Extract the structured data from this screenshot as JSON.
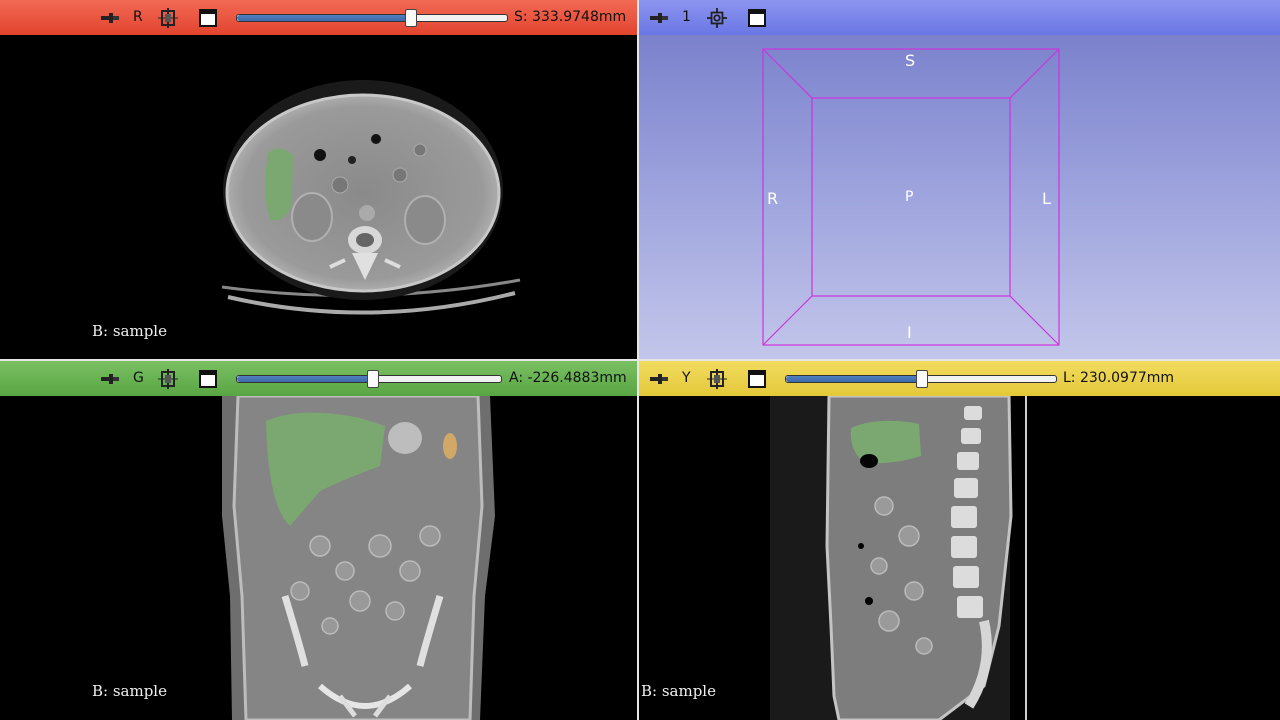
{
  "panes": {
    "red": {
      "view_label": "R",
      "offset": "S: 333.9748mm",
      "slider_fraction": 0.64,
      "caption": "B: sample"
    },
    "threed": {
      "view_label": "1",
      "orient": {
        "top": "S",
        "bottom": "I",
        "left": "R",
        "right": "L",
        "center": "P"
      }
    },
    "green": {
      "view_label": "G",
      "offset": "A: -226.4883mm",
      "slider_fraction": 0.51,
      "caption": "B: sample"
    },
    "yellow": {
      "view_label": "Y",
      "offset": "L: 230.0977mm",
      "slider_fraction": 0.5,
      "caption": "B: sample"
    }
  },
  "icons": {
    "pin": "pin-icon",
    "link": "link-icon",
    "maximize": "maximize-view-icon",
    "center": "center-view-icon"
  },
  "colors": {
    "red_bar": "#e2432e",
    "blue_bar": "#6a76e4",
    "green_bar": "#5aa543",
    "yellow_bar": "#e4c83a",
    "segment_green": "#7ba871",
    "segment_orange": "#d2a868"
  }
}
